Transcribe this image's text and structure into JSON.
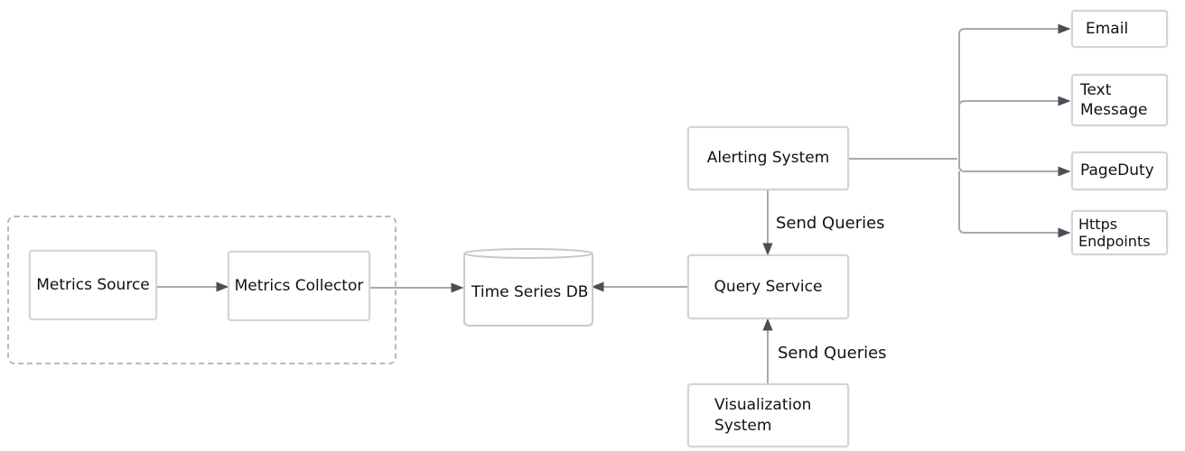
{
  "diagram": {
    "group_label": "",
    "nodes": {
      "metrics_source": "Metrics Source",
      "metrics_collector": "Metrics Collector",
      "time_series_db": "Time Series DB",
      "query_service": "Query Service",
      "alerting_system": "Alerting System",
      "visualization_system": "Visualization System",
      "email": "Email",
      "text_message": "Text Message",
      "pageduty": "PageDuty",
      "https_endpoints": "Https Endpoints"
    },
    "edge_labels": {
      "alerting_to_query": "Send Queries",
      "visualization_to_query": "Send Queries"
    },
    "edges": [
      {
        "from": "Metrics Source",
        "to": "Metrics Collector"
      },
      {
        "from": "Metrics Collector",
        "to": "Time Series DB"
      },
      {
        "from": "Query Service",
        "to": "Time Series DB"
      },
      {
        "from": "Alerting System",
        "to": "Query Service",
        "label": "Send Queries"
      },
      {
        "from": "Visualization System",
        "to": "Query Service",
        "label": "Send Queries"
      },
      {
        "from": "Alerting System",
        "to": "Email"
      },
      {
        "from": "Alerting System",
        "to": "Text Message"
      },
      {
        "from": "Alerting System",
        "to": "PageDuty"
      },
      {
        "from": "Alerting System",
        "to": "Https Endpoints"
      }
    ],
    "colors": {
      "line": "#a9a9a9",
      "border": "#d4d4d4",
      "arrow": "#4a4f57"
    }
  }
}
